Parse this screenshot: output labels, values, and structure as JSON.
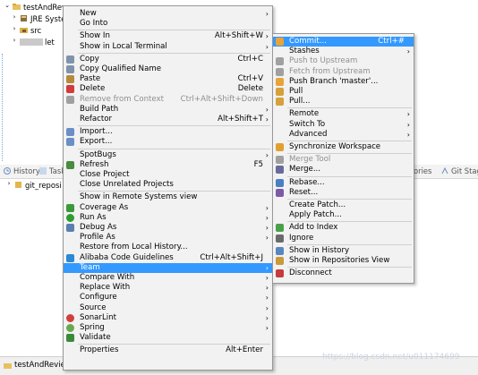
{
  "tree": {
    "project": "testAndRev",
    "jre": "JRE Syste",
    "src": "src",
    "lib": "let"
  },
  "tabs": {
    "history": "History",
    "tasks": "Task",
    "repos_right": "ories",
    "git_staging": "Git Stag",
    "git_repo_item": "git_reposi"
  },
  "status": {
    "project": "testAndReview"
  },
  "watermark": "https://blog.csdn.net/u011174699",
  "main_menu": [
    {
      "label": "New",
      "shortcut": "",
      "arrow": "›"
    },
    {
      "label": "Go Into",
      "shortcut": "",
      "arrow": ""
    },
    {
      "sep": true
    },
    {
      "label": "Show In",
      "shortcut": "Alt+Shift+W",
      "arrow": "›"
    },
    {
      "label": "Show in Local Terminal",
      "shortcut": "",
      "arrow": "›"
    },
    {
      "sep": true
    },
    {
      "label": "Copy",
      "shortcut": "Ctrl+C",
      "arrow": "",
      "icon": "copy-icon"
    },
    {
      "label": "Copy Qualified Name",
      "shortcut": "",
      "arrow": "",
      "icon": "copy-icon"
    },
    {
      "label": "Paste",
      "shortcut": "Ctrl+V",
      "arrow": "",
      "icon": "paste-icon"
    },
    {
      "label": "Delete",
      "shortcut": "Delete",
      "arrow": "",
      "icon": "delete-icon"
    },
    {
      "label": "Remove from Context",
      "shortcut": "Ctrl+Alt+Shift+Down",
      "arrow": "",
      "dis": true,
      "icon": "remove-context-icon"
    },
    {
      "label": "Build Path",
      "shortcut": "",
      "arrow": "›"
    },
    {
      "label": "Refactor",
      "shortcut": "Alt+Shift+T",
      "arrow": "›"
    },
    {
      "sep": true
    },
    {
      "label": "Import...",
      "shortcut": "",
      "arrow": "",
      "icon": "import-icon"
    },
    {
      "label": "Export...",
      "shortcut": "",
      "arrow": "",
      "icon": "export-icon"
    },
    {
      "sep": true
    },
    {
      "label": "SpotBugs",
      "shortcut": "",
      "arrow": "›"
    },
    {
      "label": "Refresh",
      "shortcut": "F5",
      "arrow": "",
      "icon": "refresh-icon"
    },
    {
      "label": "Close Project",
      "shortcut": "",
      "arrow": ""
    },
    {
      "label": "Close Unrelated Projects",
      "shortcut": "",
      "arrow": ""
    },
    {
      "sep": true
    },
    {
      "label": "Show in Remote Systems view",
      "shortcut": "",
      "arrow": ""
    },
    {
      "label": "Coverage As",
      "shortcut": "",
      "arrow": "›",
      "icon": "coverage-icon"
    },
    {
      "label": "Run As",
      "shortcut": "",
      "arrow": "›",
      "icon": "run-icon"
    },
    {
      "label": "Debug As",
      "shortcut": "",
      "arrow": "›",
      "icon": "debug-icon"
    },
    {
      "label": "Profile As",
      "shortcut": "",
      "arrow": "›"
    },
    {
      "label": "Restore from Local History...",
      "shortcut": "",
      "arrow": ""
    },
    {
      "label": "Alibaba Code Guidelines",
      "shortcut": "Ctrl+Alt+Shift+J",
      "arrow": "",
      "icon": "alibaba-icon"
    },
    {
      "label": "Team",
      "shortcut": "",
      "arrow": "›",
      "sel": true
    },
    {
      "label": "Compare With",
      "shortcut": "",
      "arrow": "›"
    },
    {
      "label": "Replace With",
      "shortcut": "",
      "arrow": "›"
    },
    {
      "label": "Configure",
      "shortcut": "",
      "arrow": "›"
    },
    {
      "label": "Source",
      "shortcut": "",
      "arrow": "›"
    },
    {
      "label": "SonarLint",
      "shortcut": "",
      "arrow": "›",
      "icon": "sonarlint-icon"
    },
    {
      "label": "Spring",
      "shortcut": "",
      "arrow": "›",
      "icon": "spring-icon"
    },
    {
      "label": "Validate",
      "shortcut": "",
      "arrow": "",
      "icon": "validate-icon"
    },
    {
      "sep": true
    },
    {
      "label": "Properties",
      "shortcut": "Alt+Enter",
      "arrow": ""
    }
  ],
  "team_menu": [
    {
      "label": "Commit...",
      "shortcut": "Ctrl+#",
      "arrow": "",
      "sel": true,
      "icon": "commit-icon"
    },
    {
      "label": "Stashes",
      "shortcut": "",
      "arrow": "›"
    },
    {
      "label": "Push to Upstream",
      "shortcut": "",
      "arrow": "",
      "dis": true,
      "icon": "push-icon"
    },
    {
      "label": "Fetch from Upstream",
      "shortcut": "",
      "arrow": "",
      "dis": true,
      "icon": "fetch-icon"
    },
    {
      "label": "Push Branch 'master'...",
      "shortcut": "",
      "arrow": "",
      "icon": "push-branch-icon"
    },
    {
      "label": "Pull",
      "shortcut": "",
      "arrow": "",
      "icon": "pull-icon"
    },
    {
      "label": "Pull...",
      "shortcut": "",
      "arrow": "",
      "icon": "pull-icon"
    },
    {
      "sep": true
    },
    {
      "label": "Remote",
      "shortcut": "",
      "arrow": "›"
    },
    {
      "label": "Switch To",
      "shortcut": "",
      "arrow": "›"
    },
    {
      "label": "Advanced",
      "shortcut": "",
      "arrow": "›"
    },
    {
      "sep": true
    },
    {
      "label": "Synchronize Workspace",
      "shortcut": "",
      "arrow": "",
      "icon": "synchronize-icon"
    },
    {
      "sep": true
    },
    {
      "label": "Merge Tool",
      "shortcut": "",
      "arrow": "",
      "dis": true,
      "icon": "merge-tool-icon"
    },
    {
      "label": "Merge...",
      "shortcut": "",
      "arrow": "",
      "icon": "merge-icon"
    },
    {
      "sep": true
    },
    {
      "label": "Rebase...",
      "shortcut": "",
      "arrow": "",
      "icon": "rebase-icon"
    },
    {
      "label": "Reset...",
      "shortcut": "",
      "arrow": "",
      "icon": "reset-icon"
    },
    {
      "sep": true
    },
    {
      "label": "Create Patch...",
      "shortcut": "",
      "arrow": ""
    },
    {
      "label": "Apply Patch...",
      "shortcut": "",
      "arrow": ""
    },
    {
      "sep": true
    },
    {
      "label": "Add to Index",
      "shortcut": "",
      "arrow": "",
      "icon": "add-index-icon"
    },
    {
      "label": "Ignore",
      "shortcut": "",
      "arrow": "",
      "icon": "ignore-icon"
    },
    {
      "sep": true
    },
    {
      "label": "Show in History",
      "shortcut": "",
      "arrow": "",
      "icon": "history-icon"
    },
    {
      "label": "Show in Repositories View",
      "shortcut": "",
      "arrow": "",
      "icon": "repositories-icon"
    },
    {
      "sep": true
    },
    {
      "label": "Disconnect",
      "shortcut": "",
      "arrow": "",
      "icon": "disconnect-icon"
    }
  ]
}
